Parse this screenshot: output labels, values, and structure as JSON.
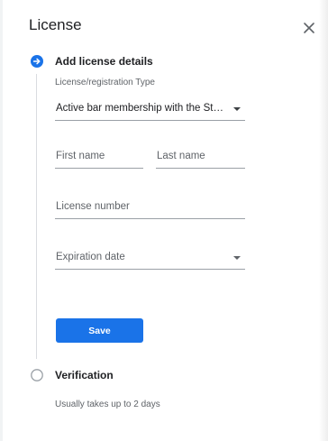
{
  "dialog": {
    "title": "License"
  },
  "step1": {
    "title": "Add license details",
    "type_label": "License/registration Type",
    "type_value": "Active bar membership with the State Bar",
    "first_name_placeholder": "First name",
    "last_name_placeholder": "Last name",
    "license_number_placeholder": "License number",
    "expiration_date_placeholder": "Expiration date",
    "save_label": "Save"
  },
  "step2": {
    "title": "Verification",
    "subtitle": "Usually takes up to 2 days"
  },
  "colors": {
    "accent": "#1a73e8",
    "text_primary": "#202124",
    "text_secondary": "#5f6368",
    "rail": "#dadce0"
  },
  "icons": {
    "close": "close-icon",
    "step_active": "arrow-right-circle-icon",
    "step_pending": "empty-circle-icon"
  }
}
